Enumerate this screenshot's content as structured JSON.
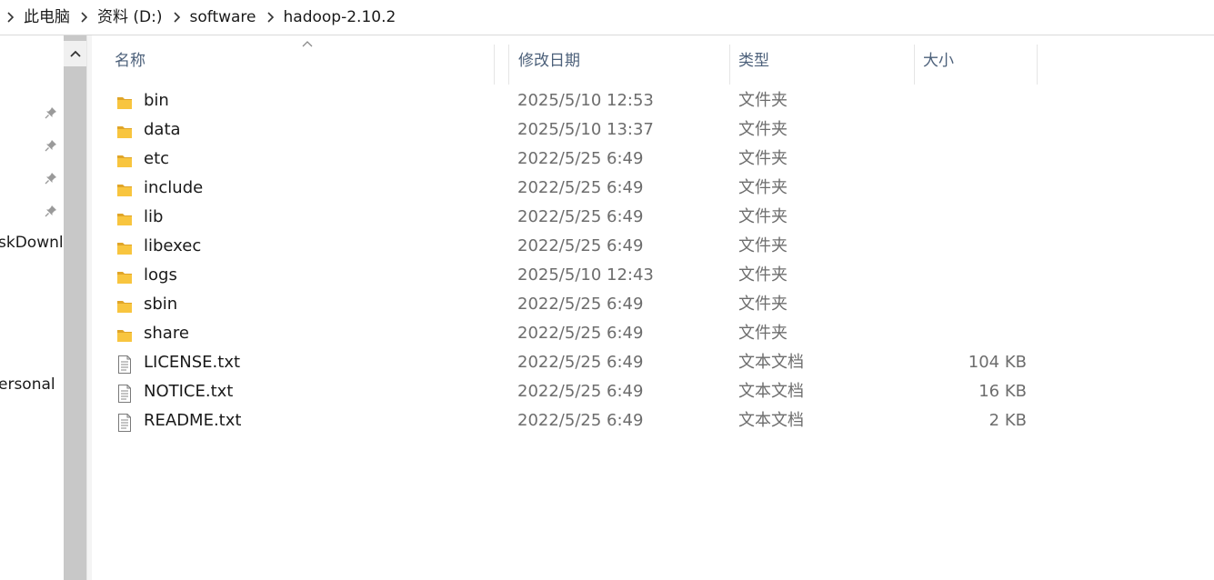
{
  "breadcrumb": [
    "此电脑",
    "资料 (D:)",
    "software",
    "hadoop-2.10.2"
  ],
  "nav": {
    "items": [
      {
        "label": "skDownlo",
        "icon": "folder-link"
      },
      {
        "label": "ersonal",
        "icon": "folder-link"
      }
    ],
    "pins": [
      "pin-icon",
      "pin-icon",
      "pin-icon",
      "pin-icon"
    ]
  },
  "columns": {
    "name": "名称",
    "date": "修改日期",
    "type": "类型",
    "size": "大小"
  },
  "files": [
    {
      "name": "bin",
      "date": "2025/5/10 12:53",
      "type": "文件夹",
      "size": "",
      "icon": "folder-icon"
    },
    {
      "name": "data",
      "date": "2025/5/10 13:37",
      "type": "文件夹",
      "size": "",
      "icon": "folder-icon"
    },
    {
      "name": "etc",
      "date": "2022/5/25 6:49",
      "type": "文件夹",
      "size": "",
      "icon": "folder-icon"
    },
    {
      "name": "include",
      "date": "2022/5/25 6:49",
      "type": "文件夹",
      "size": "",
      "icon": "folder-icon"
    },
    {
      "name": "lib",
      "date": "2022/5/25 6:49",
      "type": "文件夹",
      "size": "",
      "icon": "folder-icon"
    },
    {
      "name": "libexec",
      "date": "2022/5/25 6:49",
      "type": "文件夹",
      "size": "",
      "icon": "folder-icon"
    },
    {
      "name": "logs",
      "date": "2025/5/10 12:43",
      "type": "文件夹",
      "size": "",
      "icon": "folder-icon"
    },
    {
      "name": "sbin",
      "date": "2022/5/25 6:49",
      "type": "文件夹",
      "size": "",
      "icon": "folder-icon"
    },
    {
      "name": "share",
      "date": "2022/5/25 6:49",
      "type": "文件夹",
      "size": "",
      "icon": "folder-icon"
    },
    {
      "name": "LICENSE.txt",
      "date": "2022/5/25 6:49",
      "type": "文本文档",
      "size": "104 KB",
      "icon": "text-file-icon"
    },
    {
      "name": "NOTICE.txt",
      "date": "2022/5/25 6:49",
      "type": "文本文档",
      "size": "16 KB",
      "icon": "text-file-icon"
    },
    {
      "name": "README.txt",
      "date": "2022/5/25 6:49",
      "type": "文本文档",
      "size": "2 KB",
      "icon": "text-file-icon"
    }
  ],
  "colors": {
    "header_text": "#4c607a",
    "folder_yellow": "#f8c53f",
    "secondary_text": "#6d6d6d"
  }
}
